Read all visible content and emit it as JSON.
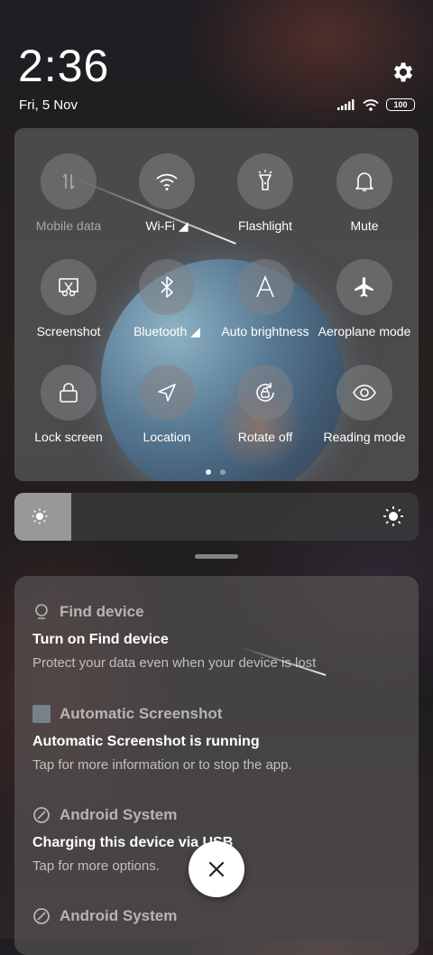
{
  "header": {
    "time": "2:36",
    "date": "Fri, 5 Nov",
    "battery_level": "100"
  },
  "quick_settings": {
    "tiles": [
      {
        "label": "Mobile data",
        "icon": "mobile-data-icon",
        "enabled": false
      },
      {
        "label": "Wi-Fi ◢",
        "icon": "wifi-icon",
        "enabled": true
      },
      {
        "label": "Flashlight",
        "icon": "flashlight-icon",
        "enabled": true
      },
      {
        "label": "Mute",
        "icon": "bell-icon",
        "enabled": true
      },
      {
        "label": "Screenshot",
        "icon": "screenshot-icon",
        "enabled": true
      },
      {
        "label": "Bluetooth ◢",
        "icon": "bluetooth-icon",
        "enabled": true
      },
      {
        "label": "Auto brightness",
        "icon": "auto-brightness-icon",
        "enabled": true
      },
      {
        "label": "Aeroplane mode",
        "icon": "airplane-icon",
        "enabled": true
      },
      {
        "label": "Lock screen",
        "icon": "lock-icon",
        "enabled": true
      },
      {
        "label": "Location",
        "icon": "location-icon",
        "enabled": true
      },
      {
        "label": "Rotate off",
        "icon": "rotate-lock-icon",
        "enabled": true
      },
      {
        "label": "Reading mode",
        "icon": "eye-icon",
        "enabled": true
      }
    ],
    "page_count": 2,
    "current_page": 1
  },
  "brightness": {
    "level_fraction": 0.14
  },
  "notifications": [
    {
      "app": "Find device",
      "icon": "location-pin-icon",
      "title": "Turn on Find device",
      "text": "Protect your data even when your device is lost"
    },
    {
      "app": "Automatic Screenshot",
      "icon": "app-square-icon",
      "title": "Automatic Screenshot is running",
      "text": "Tap for more information or to stop the app."
    },
    {
      "app": "Android System",
      "icon": "android-system-icon",
      "title": "Charging this device via USB",
      "text": "Tap for more options."
    },
    {
      "app": "Android System",
      "icon": "android-system-icon",
      "title": "",
      "text": ""
    }
  ],
  "colors": {
    "accent": "#ffffff",
    "panel": "#6e6e70"
  }
}
